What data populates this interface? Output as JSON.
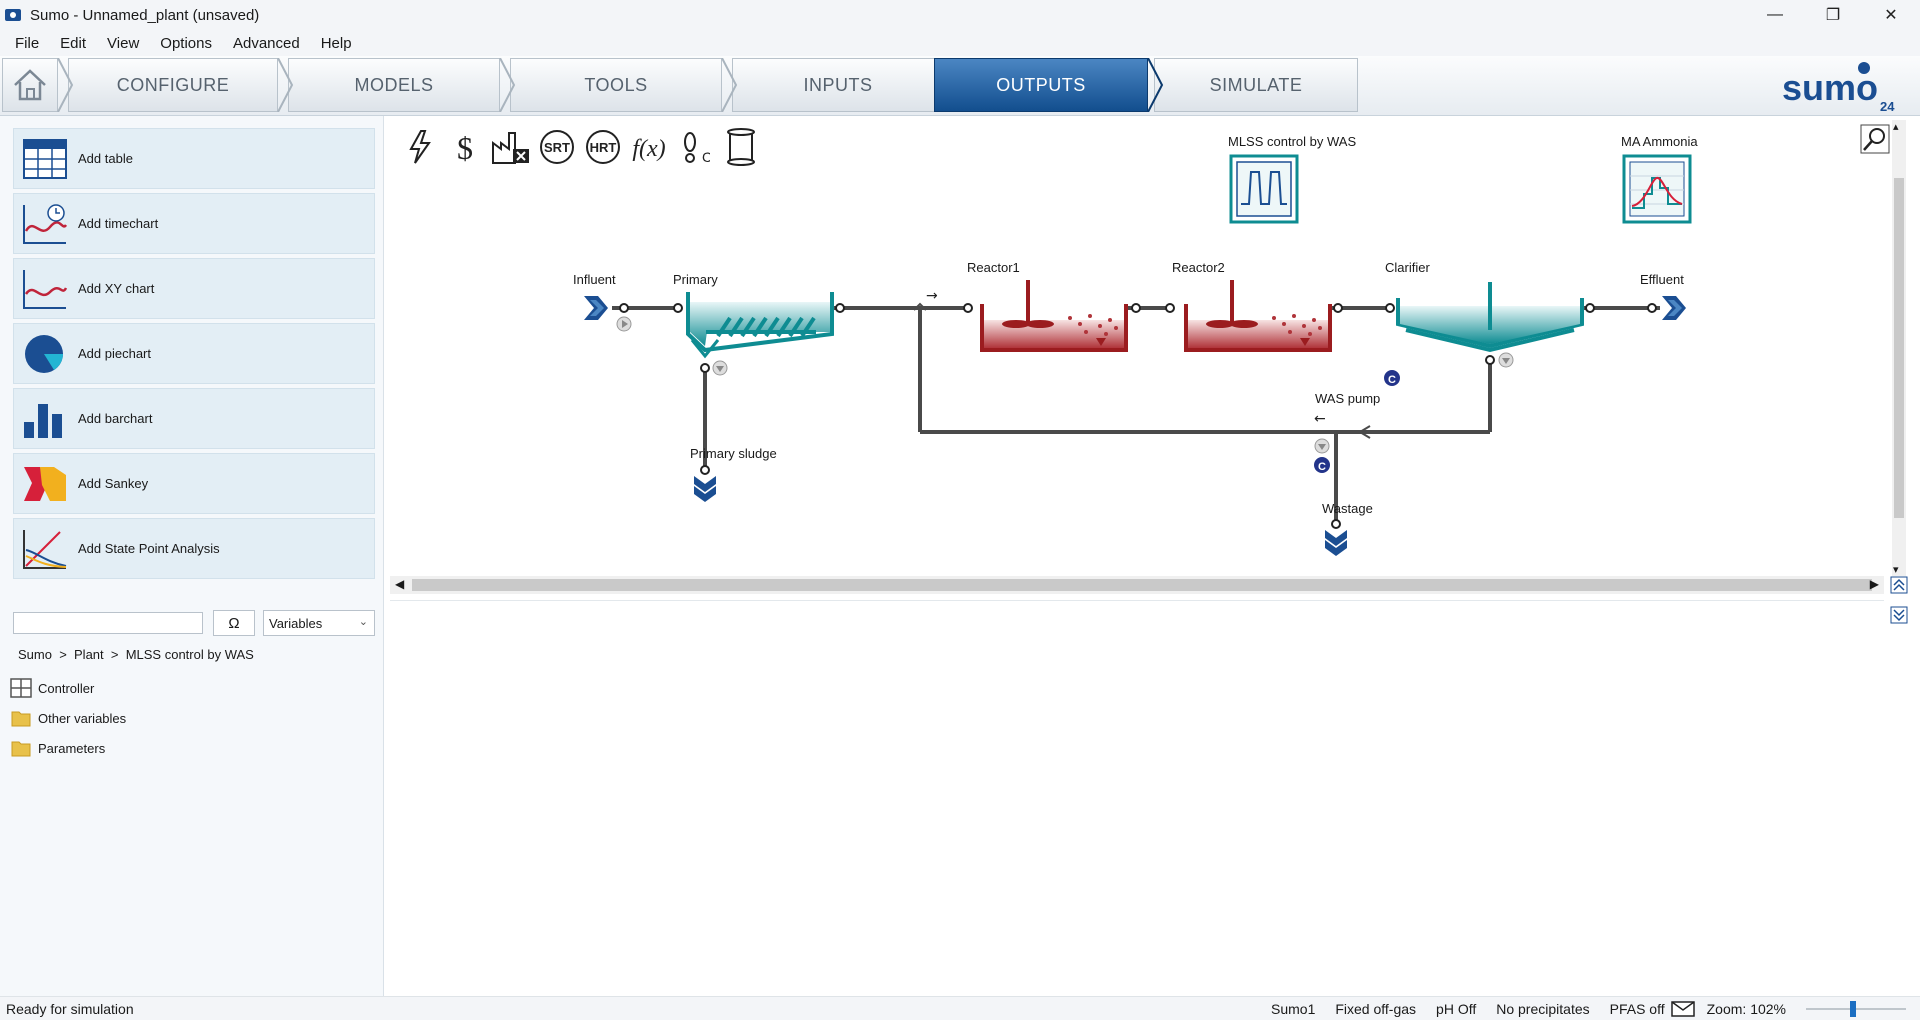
{
  "window": {
    "title": "Sumo - Unnamed_plant (unsaved)"
  },
  "menu": [
    "File",
    "Edit",
    "View",
    "Options",
    "Advanced",
    "Help"
  ],
  "nav": {
    "tabs": [
      "CONFIGURE",
      "MODELS",
      "TOOLS",
      "INPUTS",
      "OUTPUTS",
      "SIMULATE"
    ],
    "active": "OUTPUTS",
    "brand": "sumo",
    "brand_version": "24"
  },
  "left_panel": {
    "add_buttons": [
      "Add table",
      "Add timechart",
      "Add XY chart",
      "Add piechart",
      "Add barchart",
      "Add Sankey",
      "Add State Point Analysis"
    ],
    "search": {
      "value": "",
      "omega": "Ω",
      "dropdown": "Variables"
    },
    "breadcrumb": {
      "root": "Sumo",
      "sep1": "  >  ",
      "plant": "Plant",
      "sep2": "  >  ",
      "current": "MLSS control by WAS"
    },
    "tree": [
      {
        "label": "Controller",
        "icon": "grid-icon"
      },
      {
        "label": "Other variables",
        "icon": "folder-icon"
      },
      {
        "label": "Parameters",
        "icon": "folder-icon"
      }
    ]
  },
  "canvas": {
    "tools": [
      "lightning-icon",
      "dollar-icon",
      "pollutant-icon",
      "srt-icon",
      "hrt-icon",
      "function-icon",
      "footprint-icon",
      "scroll-icon"
    ],
    "tool_text": {
      "srt": "SRT",
      "hrt": "HRT",
      "fx": "f(x)"
    },
    "widgets": [
      {
        "label": "MLSS control by WAS",
        "icon": "controller-chart-icon"
      },
      {
        "label": "MA Ammonia",
        "icon": "moving-average-chart-icon"
      }
    ],
    "units": {
      "influent": "Influent",
      "primary": "Primary",
      "reactor1": "Reactor1",
      "reactor2": "Reactor2",
      "clarifier": "Clarifier",
      "effluent": "Effluent",
      "primary_sludge": "Primary sludge",
      "was_pump": "WAS pump",
      "wastage": "Wastage"
    },
    "controller_badge": "C",
    "colors": {
      "primary_blue": "#1b4e92",
      "reactor_red": "#9b1c1f",
      "clarifier_teal": "#0e8c92",
      "pipe": "#4a4a4a"
    }
  },
  "status": {
    "message": "Ready for simulation",
    "model": "Sumo1",
    "offgas": "Fixed off-gas",
    "ph": "pH Off",
    "precip": "No precipitates",
    "pfas": "PFAS off",
    "zoom": "Zoom: 102%"
  }
}
